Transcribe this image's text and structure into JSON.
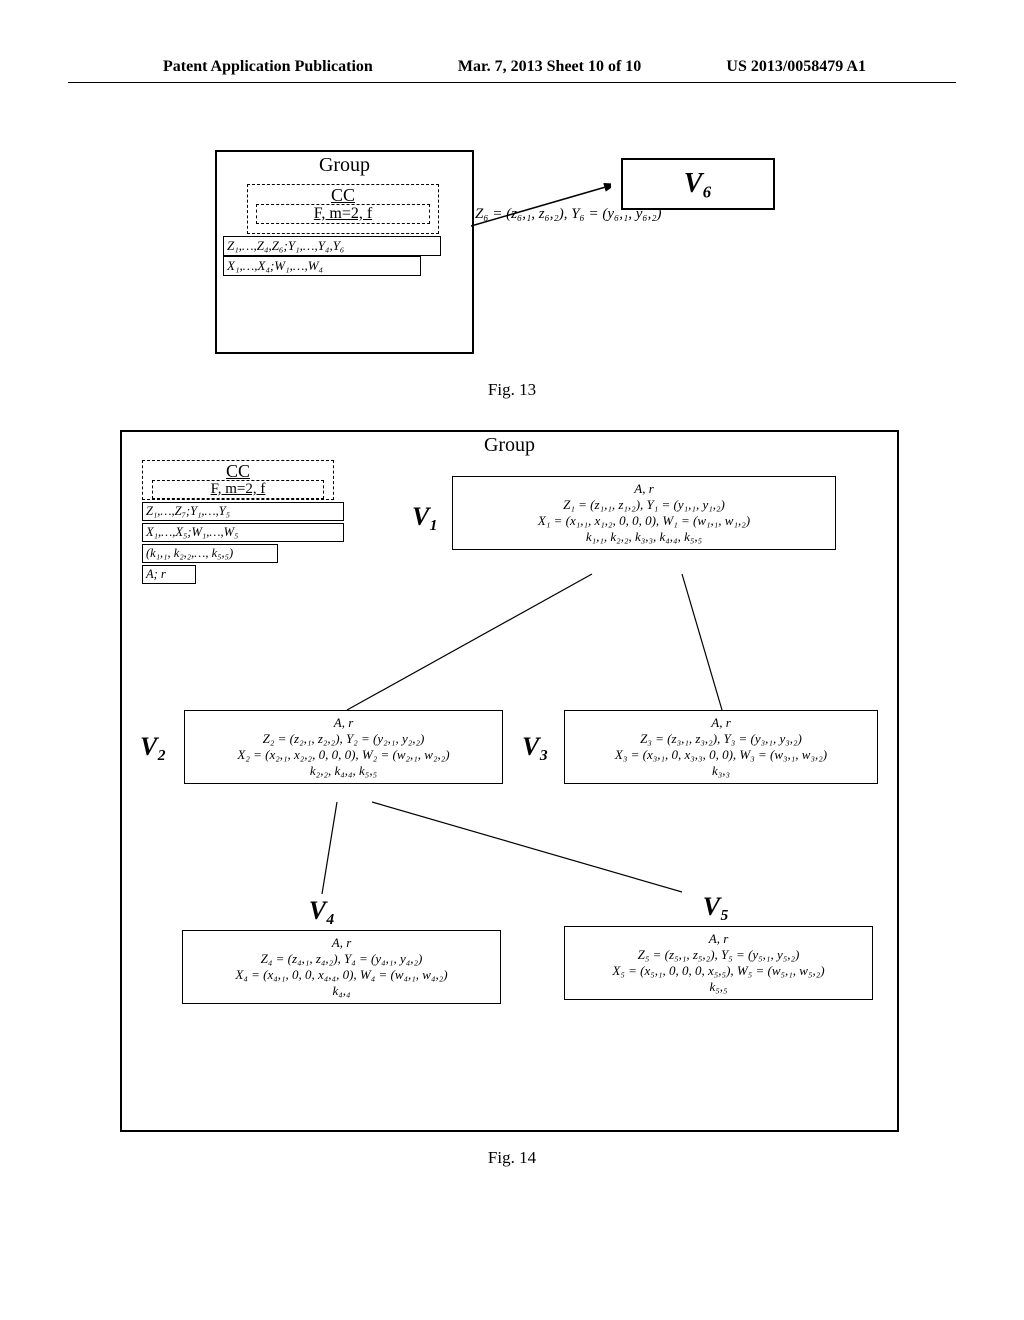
{
  "header": {
    "left": "Patent Application Publication",
    "middle": "Mar. 7, 2013  Sheet 10 of 10",
    "right": "US 2013/0058479 A1"
  },
  "fig13": {
    "group_label": "Group",
    "cc_label": "CC",
    "f_line": "F, m=2, f",
    "row1": "Z₁,…,Z₄,Z₆;Y₁,…,Y₄,Y₆",
    "row2": "X₁,…,X₄;W₁,…,W₄",
    "zy6": "Z₆ = (z₆,₁, z₆,₂), Y₆ = (y₆,₁, y₆,₂)",
    "v6": "V₆",
    "caption": "Fig. 13"
  },
  "fig14": {
    "group_label": "Group",
    "cc_label": "CC",
    "f_line": "F, m=2, f",
    "row1": "Z₁,…,Z₇;Y₁,…,Y₅",
    "row2": "X₁,…,X₅;W₁,…,W₅",
    "row3": "(k₁,₁, k₂,₂,…, k₅,₅)",
    "row4": "A; r",
    "v1": {
      "label": "V₁",
      "l0": "A, r",
      "l1": "Z₁ = (z₁,₁, z₁,₂), Y₁ = (y₁,₁, y₁,₂)",
      "l2": "X₁ = (x₁,₁, x₁,₂, 0, 0, 0), W₁ = (w₁,₁, w₁,₂)",
      "l3": "k₁,₁, k₂,₂, k₃,₃, k₄,₄, k₅,₅"
    },
    "v2": {
      "label": "V₂",
      "l0": "A, r",
      "l1": "Z₂ = (z₂,₁, z₂,₂), Y₂ = (y₂,₁, y₂,₂)",
      "l2": "X₂ = (x₂,₁, x₂,₂, 0, 0, 0), W₂ = (w₂,₁, w₂,₂)",
      "l3": "k₂,₂, k₄,₄, k₅,₅"
    },
    "v3": {
      "label": "V₃",
      "l0": "A, r",
      "l1": "Z₃ = (z₃,₁, z₃,₂), Y₃ = (y₃,₁, y₃,₂)",
      "l2": "X₃ = (x₃,₁, 0, x₃,₃, 0, 0), W₃ = (w₃,₁, w₃,₂)",
      "l3": "k₃,₃"
    },
    "v4": {
      "label": "V₄",
      "l0": "A, r",
      "l1": "Z₄ = (z₄,₁, z₄,₂), Y₄ = (y₄,₁, y₄,₂)",
      "l2": "X₄ = (x₄,₁, 0, 0, x₄,₄, 0), W₄ = (w₄,₁, w₄,₂)",
      "l3": "k₄,₄"
    },
    "v5": {
      "label": "V₅",
      "l0": "A, r",
      "l1": "Z₅ = (z₅,₁, z₅,₂), Y₅ = (y₅,₁, y₅,₂)",
      "l2": "X₅ = (x₅,₁, 0, 0, 0, x₅,₅), W₅ = (w₅,₁, w₅,₂)",
      "l3": "k₅,₅"
    },
    "caption": "Fig. 14"
  }
}
